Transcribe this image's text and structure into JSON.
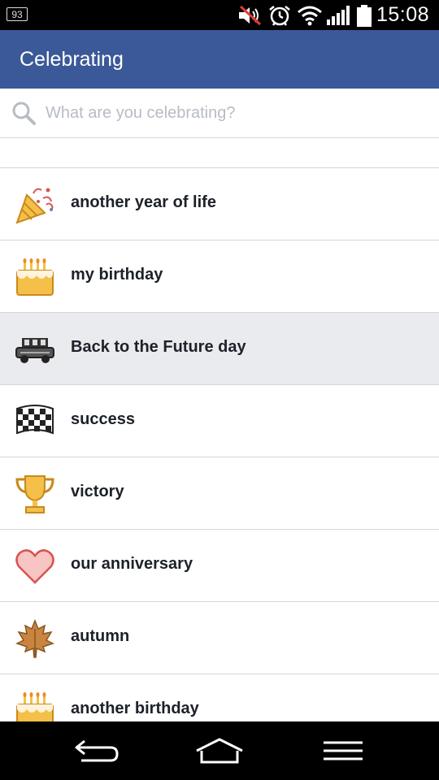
{
  "status_bar": {
    "notification_badge": "93",
    "time": "15:08",
    "icons": [
      "notification-badge-icon",
      "muted-volume-icon",
      "alarm-icon",
      "wifi-icon",
      "signal-icon",
      "battery-icon"
    ]
  },
  "app_bar": {
    "title": "Celebrating"
  },
  "search": {
    "placeholder": "What are you celebrating?",
    "value": ""
  },
  "list": {
    "items": [
      {
        "label": "another year of life",
        "icon": "party-popper-icon"
      },
      {
        "label": "my birthday",
        "icon": "birthday-cake-icon"
      },
      {
        "label": "Back to the Future day",
        "icon": "delorean-car-icon",
        "active": true
      },
      {
        "label": "success",
        "icon": "checkered-flag-icon"
      },
      {
        "label": "victory",
        "icon": "trophy-icon"
      },
      {
        "label": "our anniversary",
        "icon": "heart-icon"
      },
      {
        "label": "autumn",
        "icon": "maple-leaf-icon"
      },
      {
        "label": "another birthday",
        "icon": "birthday-cake-icon"
      }
    ]
  },
  "nav_bar": {
    "buttons": [
      "back-icon",
      "home-icon",
      "menu-icon"
    ]
  },
  "colors": {
    "app_bar": "#3b5998",
    "active_row": "#e9ebee",
    "divider": "#d4d6da",
    "text": "#1d2129"
  }
}
